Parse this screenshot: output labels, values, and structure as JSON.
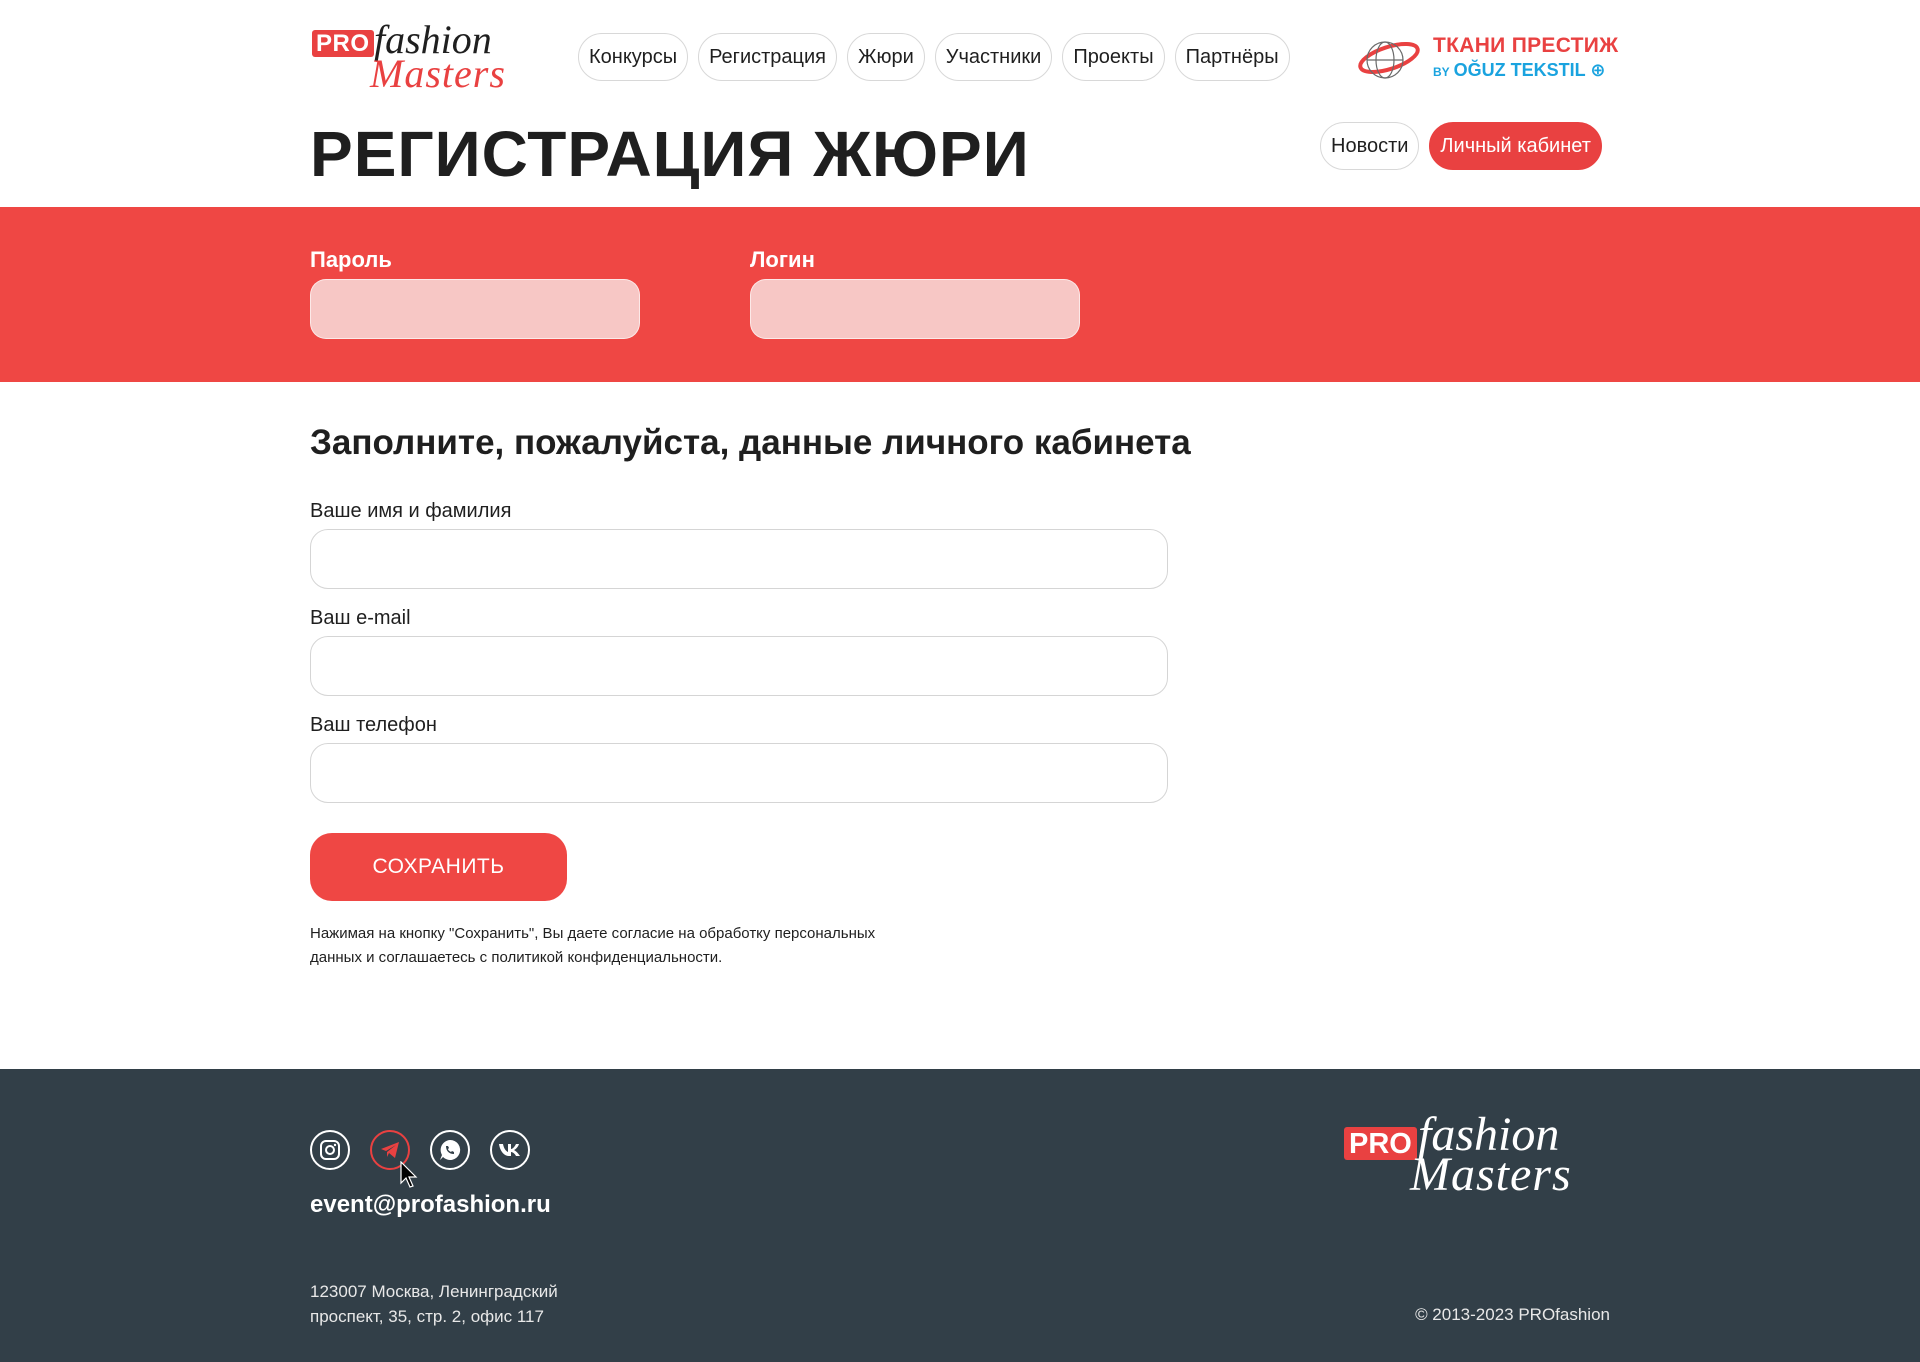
{
  "colors": {
    "accent": "#ef4744",
    "input_on_accent": "#f7c7c5",
    "footer_bg": "#323f48",
    "partner_blue": "#1aa3df"
  },
  "logo": {
    "pro": "PRO",
    "fashion": "fashion",
    "masters": "Masters"
  },
  "nav": {
    "items": [
      {
        "label": "Конкурсы"
      },
      {
        "label": "Регистрация"
      },
      {
        "label": "Жюри"
      },
      {
        "label": "Участники"
      },
      {
        "label": "Проекты"
      },
      {
        "label": "Партнёры"
      }
    ]
  },
  "partner": {
    "line1": "ТКАНИ ПРЕСТИЖ",
    "by": "BY",
    "line2": "OĞUZ TEKSTIL"
  },
  "page": {
    "title": "РЕГИСТРАЦИЯ ЖЮРИ",
    "news_label": "Новости",
    "cabinet_label": "Личный кабинет"
  },
  "credentials": {
    "password_label": "Пароль",
    "password_value": "",
    "login_label": "Логин",
    "login_value": ""
  },
  "form": {
    "title": "Заполните, пожалуйста, данные личного кабинета",
    "name_label": "Ваше имя и фамилия",
    "name_value": "",
    "email_label": "Ваш e-mail",
    "email_value": "",
    "phone_label": "Ваш телефон",
    "phone_value": "",
    "save_label": "СОХРАНИТЬ",
    "consent_line1": "Нажимая на кнопку \"Сохранить\", Вы даете согласие на обработку персональных",
    "consent_line2": "данных и соглашаетесь с политикой конфиденциальности."
  },
  "footer": {
    "social_icons": [
      "instagram-icon",
      "telegram-icon",
      "whatsapp-icon",
      "vk-icon"
    ],
    "email": "event@profashion.ru",
    "address_line1": "123007 Москва, Ленинградский",
    "address_line2": "проспект, 35, стр. 2, офис 117",
    "copyright": "© 2013-2023 PROfashion",
    "logo": {
      "pro": "PRO",
      "fashion": "fashion",
      "masters": "Masters"
    }
  }
}
